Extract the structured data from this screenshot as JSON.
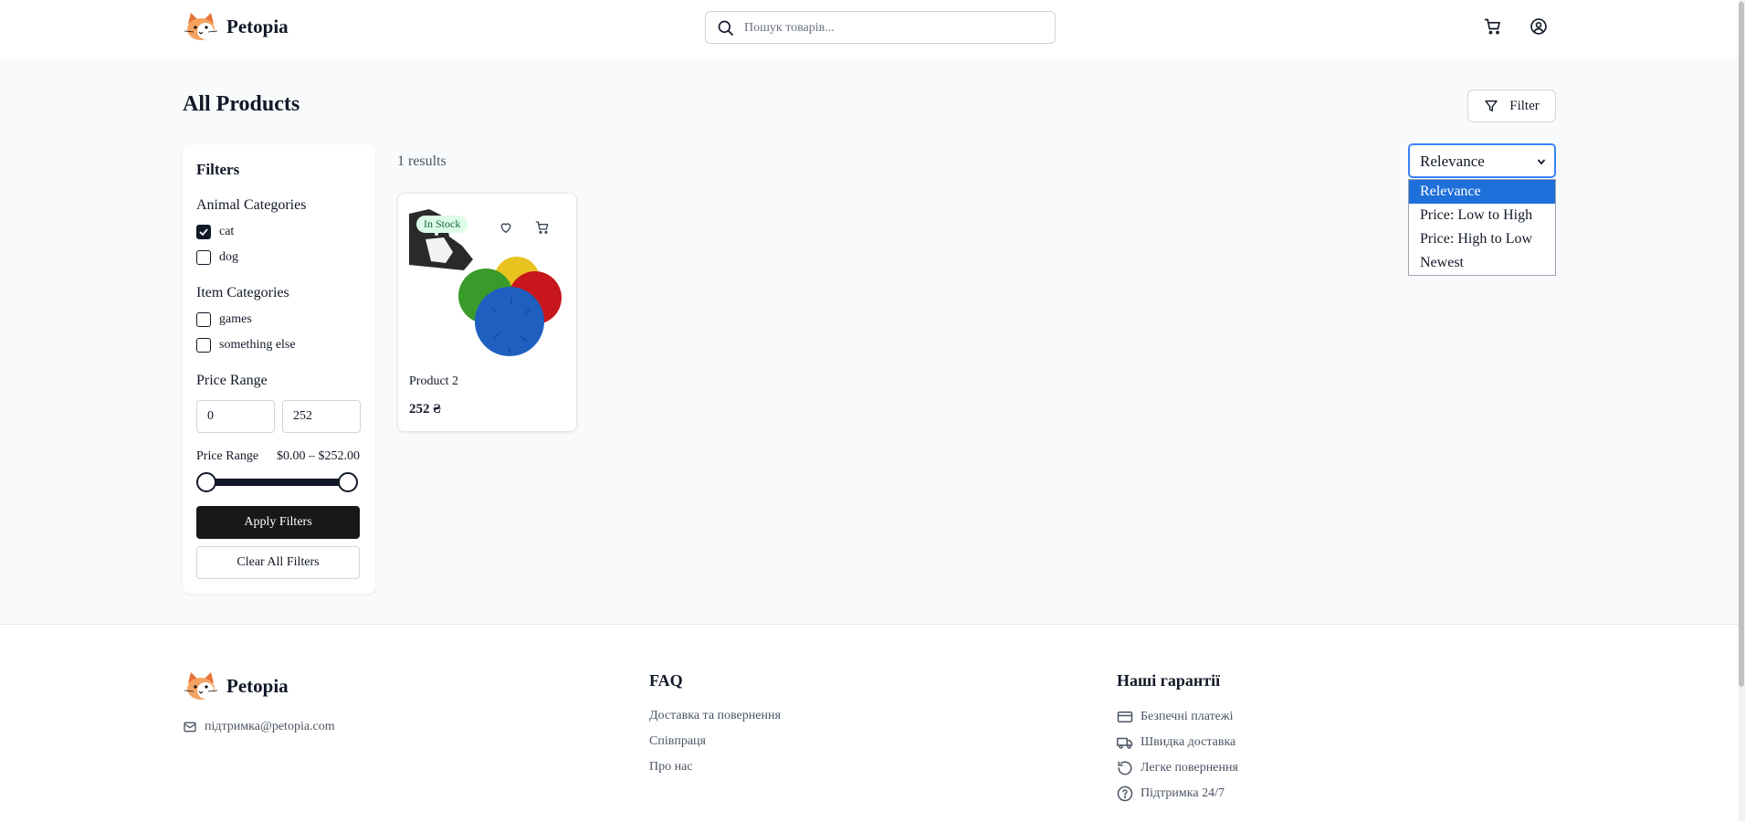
{
  "header": {
    "brand": "Petopia",
    "search_placeholder": "Пошук товарів...",
    "icons": [
      "logo-cat-icon",
      "search-icon",
      "cart-icon",
      "user-icon"
    ]
  },
  "main": {
    "title": "All Products",
    "filter_button": "Filter",
    "results": "1 results"
  },
  "sidebar": {
    "title": "Filters",
    "animal_categories": {
      "title": "Animal Categories",
      "items": [
        {
          "label": "cat",
          "checked": true
        },
        {
          "label": "dog",
          "checked": false
        }
      ]
    },
    "item_categories": {
      "title": "Item Categories",
      "items": [
        {
          "label": "games",
          "checked": false
        },
        {
          "label": "something else",
          "checked": false
        }
      ]
    },
    "price_range": {
      "title": "Price Range",
      "min": "0",
      "max": "252",
      "label": "Price Range",
      "display": "$0.00 – $252.00"
    },
    "apply": "Apply Filters",
    "clear": "Clear All Filters"
  },
  "sort": {
    "selected": "Relevance",
    "options": [
      "Relevance",
      "Price: Low to High",
      "Price: High to Low",
      "Newest"
    ]
  },
  "products": [
    {
      "badge": "In Stock",
      "name": "Product 2",
      "price": "252 ₴"
    }
  ],
  "footer": {
    "brand": "Petopia",
    "email": "підтримка@petopia.com",
    "faq": {
      "title": "FAQ",
      "links": [
        "Доставка та повернення",
        "Співпраця",
        "Про нас"
      ]
    },
    "guarantees": {
      "title": "Наші гарантії",
      "items": [
        {
          "icon": "credit-card-icon",
          "label": "Безпечні платежі"
        },
        {
          "icon": "truck-icon",
          "label": "Швидка доставка"
        },
        {
          "icon": "rotate-icon",
          "label": "Легке повернення"
        },
        {
          "icon": "help-circle-icon",
          "label": "Підтримка 24/7"
        }
      ]
    }
  },
  "colors": {
    "accent": "#3b82f6",
    "dropdown_selected": "#1e6fd9",
    "primary_button": "#18181b",
    "badge_bg": "#dcfce7",
    "badge_text": "#166534",
    "page_bg": "#f8fafc"
  }
}
